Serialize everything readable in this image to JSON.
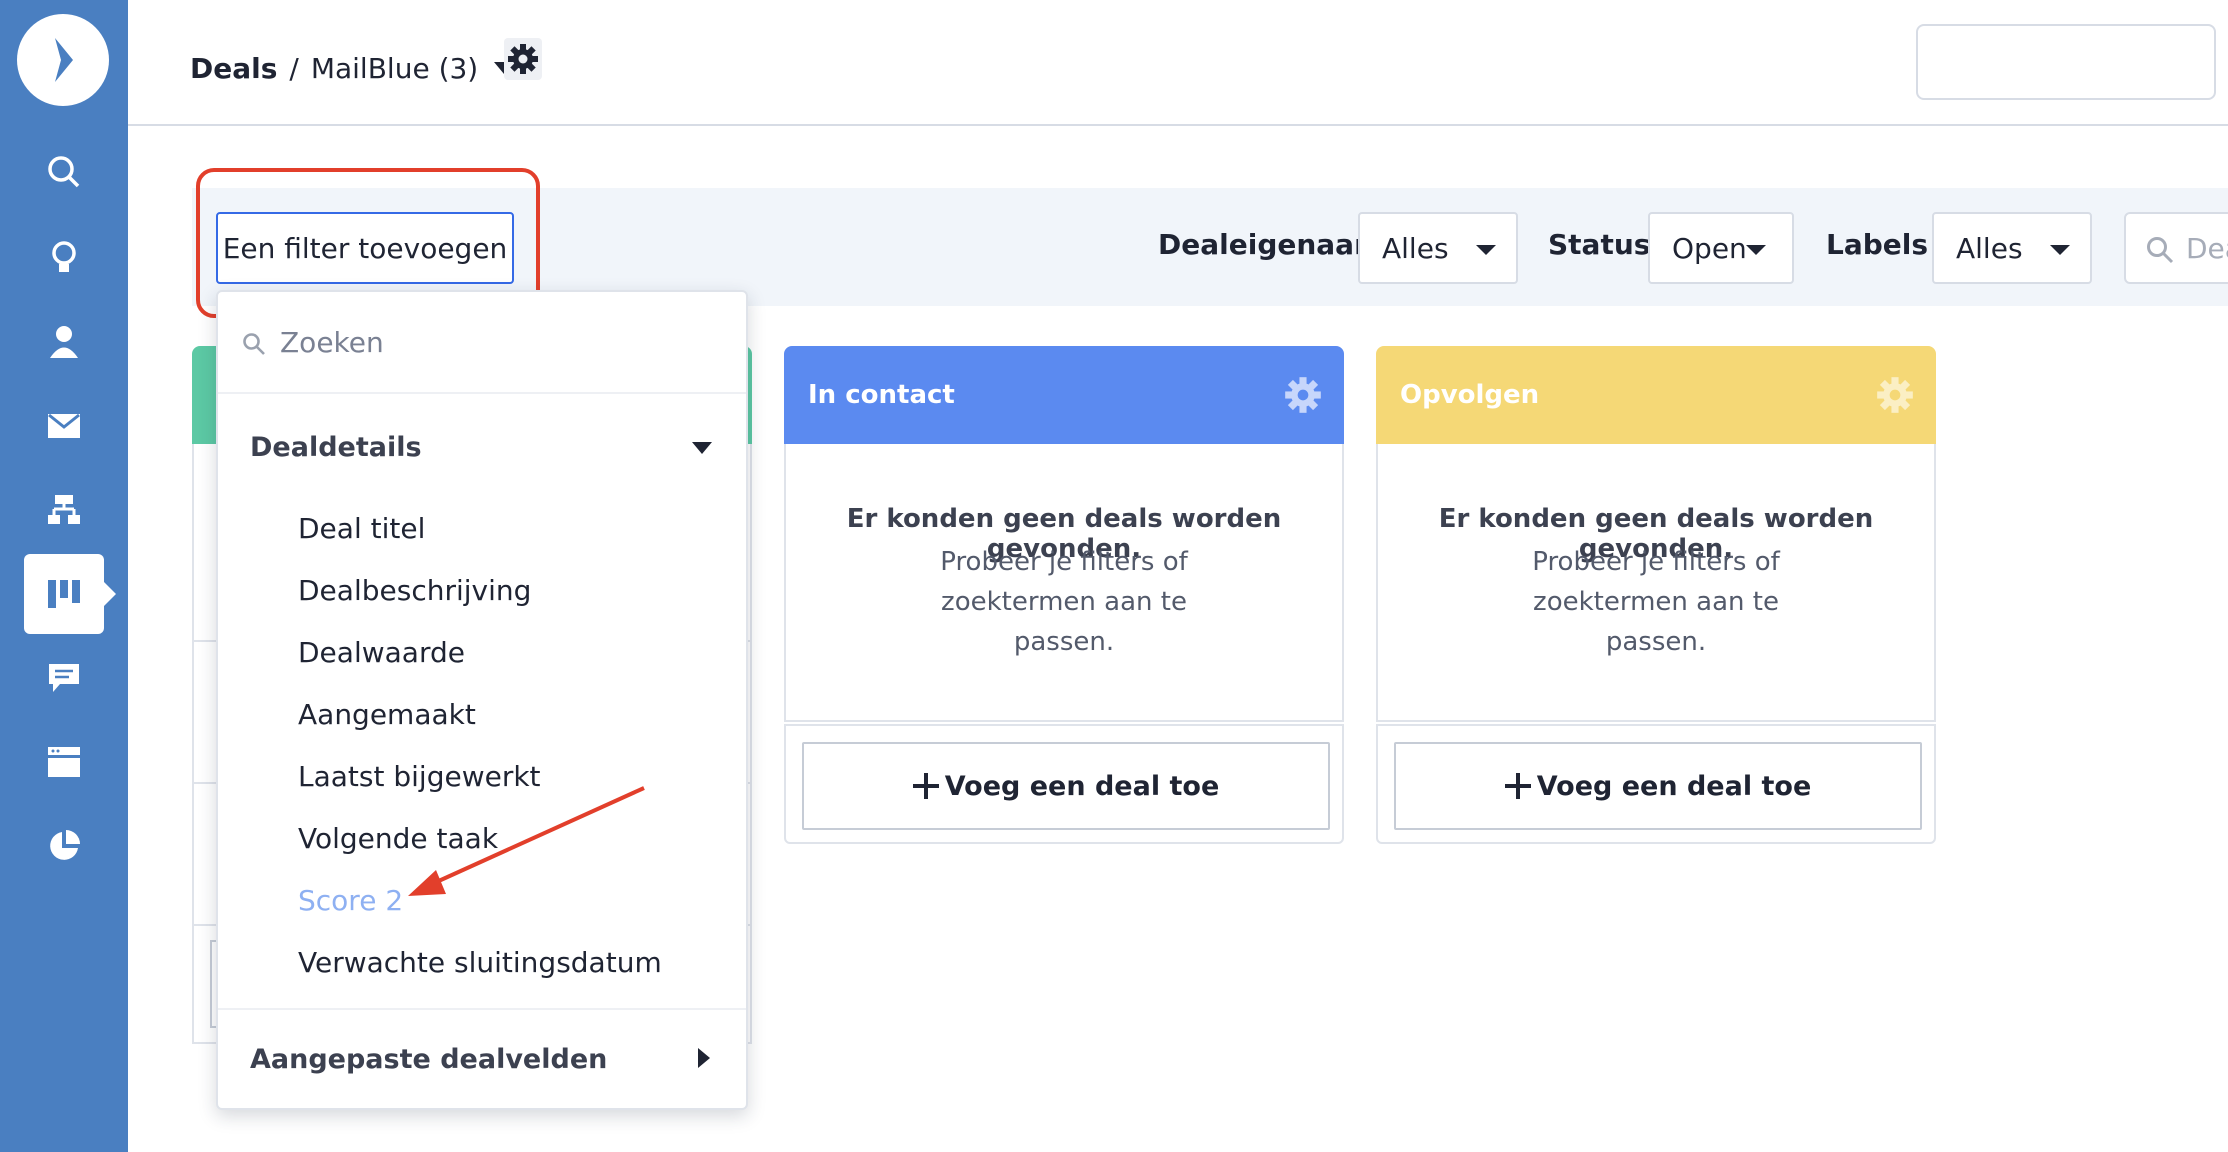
{
  "header": {
    "breadcrumb_root": "Deals",
    "breadcrumb_separator": "/",
    "pipeline_name": "MailBlue (3)"
  },
  "filter_bar": {
    "add_filter_label": "Een filter toevoegen",
    "owners_label": "Dealeigenaars",
    "owners_value": "Alles",
    "status_label": "Status",
    "status_value": "Open",
    "labels_label": "Labels",
    "labels_value": "Alles",
    "search_placeholder": "Deal"
  },
  "dropdown": {
    "search_placeholder": "Zoeken",
    "section_details": "Dealdetails",
    "items": [
      "Deal titel",
      "Dealbeschrijving",
      "Dealwaarde",
      "Aangemaakt",
      "Laatst bijgewerkt",
      "Volgende taak",
      "Score 2",
      "Verwachte sluitingsdatum"
    ],
    "section_custom": "Aangepaste dealvelden"
  },
  "columns": [
    {
      "title": "In contact",
      "color": "#5b8af0",
      "empty_title": "Er konden geen deals worden gevonden.",
      "empty_sub": "Probeer je filters of zoektermen aan te passen.",
      "add_label": "Voeg een deal toe"
    },
    {
      "title": "Opvolgen",
      "color": "#f5d876",
      "empty_title": "Er konden geen deals worden gevonden.",
      "empty_sub": "Probeer je filters of zoektermen aan te passen.",
      "add_label": "Voeg een deal toe"
    }
  ],
  "hidden_column_color": "#5cc9a4",
  "colors": {
    "sidebar": "#4a7fc1",
    "highlight": "#e23f2b",
    "accent": "#356ae6"
  },
  "sidebar_icons": [
    "logo-icon",
    "search-icon",
    "lightbulb-icon",
    "contact-icon",
    "envelope-icon",
    "automation-icon",
    "deals-pipeline-icon",
    "conversations-icon",
    "site-icon",
    "reports-icon"
  ]
}
